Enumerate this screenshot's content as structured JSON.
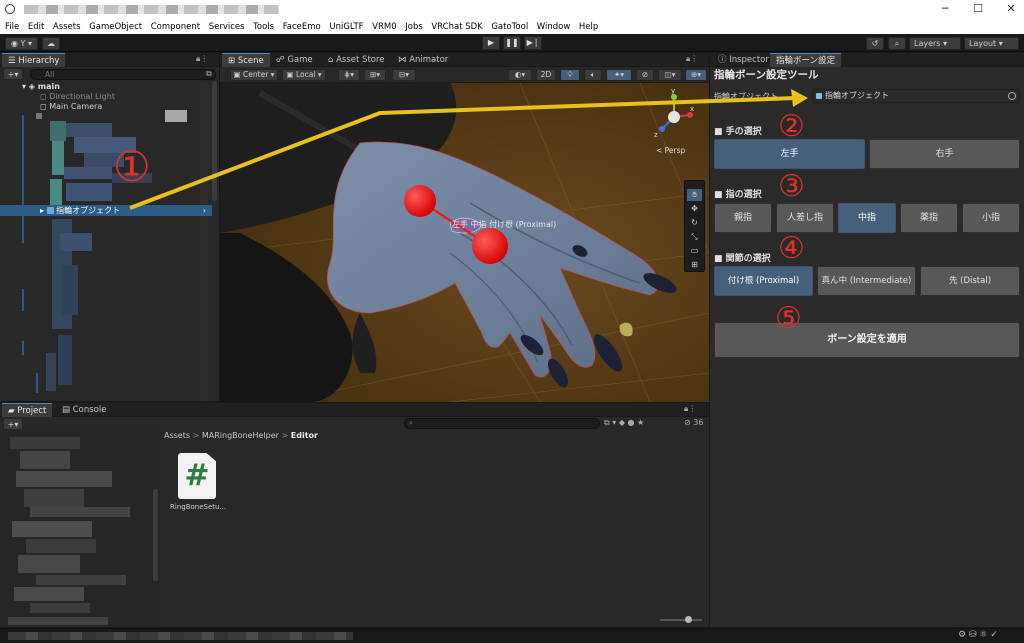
{
  "window": {
    "minimize_icon": "minimize-icon",
    "maximize_icon": "maximize-icon",
    "close_icon": "close-icon",
    "minimize_glyph": "─",
    "maximize_glyph": "☐",
    "close_glyph": "✕"
  },
  "menu": [
    "File",
    "Edit",
    "Assets",
    "GameObject",
    "Component",
    "Services",
    "Tools",
    "FaceEmo",
    "UniGLTF",
    "VRM0",
    "Jobs",
    "VRChat SDK",
    "GatoTool",
    "Window",
    "Help"
  ],
  "toolbar": {
    "account_label": "Y",
    "layers_label": "Layers",
    "layout_label": "Layout",
    "play_glyph": "▶",
    "pause_glyph": "❚❚",
    "step_glyph": "▶❘"
  },
  "hierarchy": {
    "tab_label": "Hierarchy",
    "search_placeholder": "All",
    "scene_name": "main",
    "items": [
      "Directional Light",
      "Main Camera"
    ],
    "selected_item": "指輪オブジェクト"
  },
  "scene_tabs": [
    "Scene",
    "Game",
    "Asset Store",
    "Animator"
  ],
  "scene_toolbar": {
    "pivot_label": "Center",
    "space_label": "Local",
    "mode_2d_label": "2D"
  },
  "scene_view": {
    "bone_label": "左手 中指 付け根 (Proximal)",
    "persp_label": "< Persp",
    "gizmo_axis_x": "x",
    "gizmo_axis_y": "y",
    "gizmo_axis_z": "z"
  },
  "project": {
    "tab_project": "Project",
    "tab_console": "Console",
    "breadcrumb": [
      "Assets",
      "MARingBoneHelper",
      "Editor"
    ],
    "file_name": "RingBoneSetu...",
    "file_icon_glyph": "#",
    "hidden_count": "36"
  },
  "inspector": {
    "tab_inspector": "Inspector",
    "tab_tool": "指輪ボーン設定",
    "title": "指輪ボーン設定ツール",
    "object_field_label": "指輪オブジェクト",
    "object_field_value": "指輪オブジェクト",
    "hand_section": "■ 手の選択",
    "hands": [
      "左手",
      "右手"
    ],
    "finger_section": "■ 指の選択",
    "fingers": [
      "親指",
      "人差し指",
      "中指",
      "薬指",
      "小指"
    ],
    "joint_section": "■ 関節の選択",
    "joints": [
      "付け根 (Proximal)",
      "真ん中 (Intermediate)",
      "先 (Distal)"
    ],
    "apply_button": "ボーン設定を適用",
    "selected": {
      "hand": 0,
      "finger": 2,
      "joint": 0
    }
  },
  "annotations": [
    "①",
    "②",
    "③",
    "④",
    "⑤"
  ],
  "colors": {
    "accent_blue": "#46607c",
    "annotation_red": "#e0302a",
    "arrow_yellow": "#e8c11c",
    "scene_bg": "#5a3a12"
  }
}
